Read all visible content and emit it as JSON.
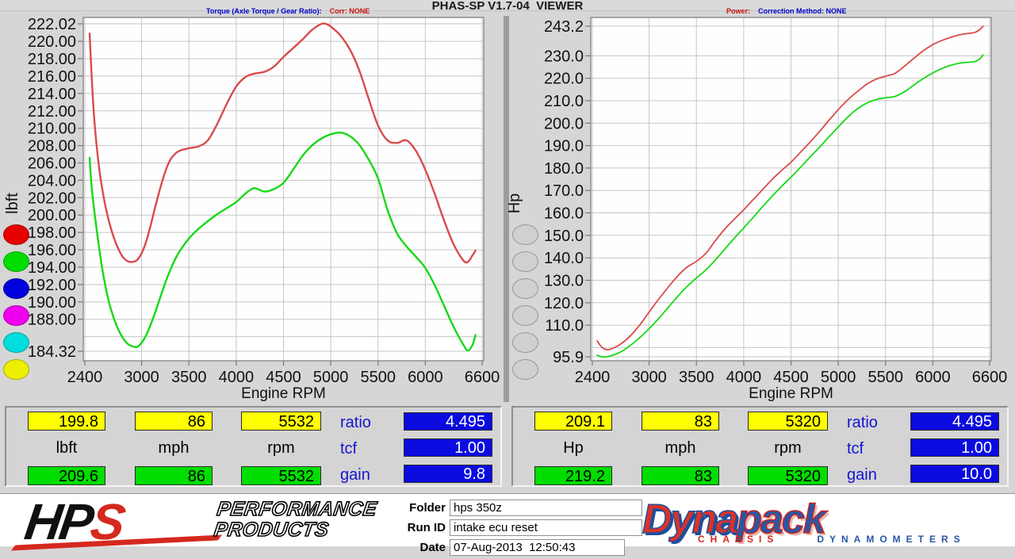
{
  "window": {
    "title": "PHAS-SP V1.7-04_VIEWER"
  },
  "header": {
    "torque_label": "Torque (Axle Torque / Gear Ratio):",
    "torque_corr": "Corr: NONE",
    "power_label": "Power:",
    "power_corr": "Correction Method: NONE"
  },
  "run_buttons": {
    "left": [
      {
        "name": "red",
        "color": "#e60000"
      },
      {
        "name": "green",
        "color": "#00dd00"
      },
      {
        "name": "blue",
        "color": "#0000dd"
      },
      {
        "name": "magenta",
        "color": "#ee00ee"
      },
      {
        "name": "cyan",
        "color": "#00dddd"
      },
      {
        "name": "yellow",
        "color": "#eeee00"
      }
    ],
    "right": [
      {
        "name": "slot-1",
        "color": "#d0d0d0"
      },
      {
        "name": "slot-2",
        "color": "#d0d0d0"
      },
      {
        "name": "slot-3",
        "color": "#d0d0d0"
      },
      {
        "name": "slot-4",
        "color": "#d0d0d0"
      },
      {
        "name": "slot-5",
        "color": "#d0d0d0"
      },
      {
        "name": "slot-6",
        "color": "#d0d0d0"
      }
    ]
  },
  "chart_data": [
    {
      "type": "line",
      "title": "Torque",
      "xlabel": "Engine RPM",
      "ylabel": "lbft",
      "xlim": [
        2400,
        6600
      ],
      "ylim": [
        184.32,
        222.02
      ],
      "grid": true,
      "x_ticks": [
        2400,
        3000,
        3500,
        4000,
        4500,
        5000,
        5500,
        6000,
        6600
      ],
      "x_tick_labels": [
        "2400",
        "3000",
        "3500",
        "4000",
        "4500",
        "5000",
        "5500",
        "6000",
        "6600"
      ],
      "y_ticks": [
        222.02,
        220,
        218,
        216,
        214,
        212,
        210,
        208,
        206,
        204,
        202,
        200,
        198,
        196,
        194,
        192,
        190,
        188,
        186,
        184.32
      ],
      "y_tick_labels": [
        "222.02",
        "220.00",
        "218.00",
        "216.00",
        "214.00",
        "212.00",
        "210.00",
        "208.00",
        "206.00",
        "204.00",
        "202.00",
        "200.00",
        "198.00",
        "196.00",
        "194.00",
        "192.00",
        "190.00",
        "188.00",
        "",
        "184.32"
      ],
      "series": [
        {
          "name": "red-run-torque",
          "color": "#d94b4b",
          "points": [
            [
              2450,
              220.9
            ],
            [
              2470,
              216.5
            ],
            [
              2500,
              211.0
            ],
            [
              2550,
              205.5
            ],
            [
              2600,
              202.0
            ],
            [
              2650,
              199.5
            ],
            [
              2700,
              197.6
            ],
            [
              2750,
              196.2
            ],
            [
              2800,
              195.2
            ],
            [
              2850,
              194.7
            ],
            [
              2900,
              194.6
            ],
            [
              2950,
              194.8
            ],
            [
              3000,
              195.6
            ],
            [
              3050,
              197.0
            ],
            [
              3100,
              199.0
            ],
            [
              3150,
              201.2
            ],
            [
              3200,
              203.2
            ],
            [
              3250,
              205.0
            ],
            [
              3300,
              206.3
            ],
            [
              3350,
              207.0
            ],
            [
              3400,
              207.4
            ],
            [
              3500,
              207.7
            ],
            [
              3600,
              207.9
            ],
            [
              3700,
              208.6
            ],
            [
              3800,
              210.5
            ],
            [
              3900,
              212.8
            ],
            [
              4000,
              214.8
            ],
            [
              4100,
              215.9
            ],
            [
              4200,
              216.3
            ],
            [
              4300,
              216.5
            ],
            [
              4400,
              217.1
            ],
            [
              4500,
              218.2
            ],
            [
              4600,
              219.2
            ],
            [
              4700,
              220.2
            ],
            [
              4800,
              221.3
            ],
            [
              4900,
              222.0
            ],
            [
              4950,
              222.0
            ],
            [
              5000,
              221.7
            ],
            [
              5100,
              220.7
            ],
            [
              5200,
              219.1
            ],
            [
              5300,
              216.7
            ],
            [
              5400,
              213.4
            ],
            [
              5500,
              210.3
            ],
            [
              5600,
              208.6
            ],
            [
              5700,
              208.3
            ],
            [
              5800,
              208.6
            ],
            [
              5900,
              207.4
            ],
            [
              6000,
              205.2
            ],
            [
              6100,
              202.4
            ],
            [
              6200,
              199.3
            ],
            [
              6300,
              196.6
            ],
            [
              6400,
              194.8
            ],
            [
              6450,
              194.6
            ],
            [
              6500,
              195.4
            ],
            [
              6530,
              195.9
            ]
          ]
        },
        {
          "name": "green-run-torque",
          "color": "#16d916",
          "points": [
            [
              2450,
              206.6
            ],
            [
              2470,
              203.5
            ],
            [
              2500,
              200.5
            ],
            [
              2550,
              196.3
            ],
            [
              2600,
              192.8
            ],
            [
              2650,
              190.2
            ],
            [
              2700,
              188.3
            ],
            [
              2750,
              186.9
            ],
            [
              2800,
              185.9
            ],
            [
              2850,
              185.2
            ],
            [
              2900,
              184.9
            ],
            [
              2950,
              184.8
            ],
            [
              3000,
              185.3
            ],
            [
              3050,
              186.2
            ],
            [
              3100,
              187.5
            ],
            [
              3150,
              189.0
            ],
            [
              3200,
              190.6
            ],
            [
              3250,
              192.2
            ],
            [
              3300,
              193.6
            ],
            [
              3350,
              194.8
            ],
            [
              3400,
              195.8
            ],
            [
              3500,
              197.3
            ],
            [
              3600,
              198.4
            ],
            [
              3700,
              199.3
            ],
            [
              3800,
              200.1
            ],
            [
              3900,
              200.8
            ],
            [
              4000,
              201.5
            ],
            [
              4100,
              202.5
            ],
            [
              4150,
              202.9
            ],
            [
              4200,
              203.1
            ],
            [
              4300,
              202.7
            ],
            [
              4400,
              203.0
            ],
            [
              4500,
              203.7
            ],
            [
              4600,
              205.2
            ],
            [
              4700,
              206.8
            ],
            [
              4800,
              208.0
            ],
            [
              4900,
              208.8
            ],
            [
              5000,
              209.3
            ],
            [
              5100,
              209.5
            ],
            [
              5200,
              209.1
            ],
            [
              5300,
              208.1
            ],
            [
              5400,
              206.4
            ],
            [
              5500,
              204.2
            ],
            [
              5600,
              200.6
            ],
            [
              5700,
              197.9
            ],
            [
              5800,
              196.4
            ],
            [
              5900,
              195.2
            ],
            [
              6000,
              193.9
            ],
            [
              6100,
              191.9
            ],
            [
              6200,
              189.5
            ],
            [
              6300,
              187.1
            ],
            [
              6400,
              185.1
            ],
            [
              6450,
              184.4
            ],
            [
              6500,
              185.1
            ],
            [
              6530,
              186.2
            ]
          ]
        }
      ]
    },
    {
      "type": "line",
      "title": "Power",
      "xlabel": "Engine RPM",
      "ylabel": "Hp",
      "xlim": [
        2400,
        6600
      ],
      "ylim": [
        95.9,
        243.2
      ],
      "grid": true,
      "x_ticks": [
        2400,
        3000,
        3500,
        4000,
        4500,
        5000,
        5500,
        6000,
        6600
      ],
      "x_tick_labels": [
        "2400",
        "3000",
        "3500",
        "4000",
        "4500",
        "5000",
        "5500",
        "6000",
        "6600"
      ],
      "y_ticks": [
        243.2,
        230,
        220,
        210,
        200,
        190,
        180,
        170,
        160,
        150,
        140,
        130,
        120,
        110,
        100,
        95.9
      ],
      "y_tick_labels": [
        "243.2",
        "230.0",
        "220.0",
        "210.0",
        "200.0",
        "190.0",
        "180.0",
        "170.0",
        "160.0",
        "150.0",
        "140.0",
        "130.0",
        "120.0",
        "110.0",
        "",
        "95.9"
      ],
      "series": [
        {
          "name": "red-run-power",
          "color": "#d94b4b",
          "points": [
            [
              2450,
              103.0
            ],
            [
              2500,
              100.2
            ],
            [
              2550,
              99.1
            ],
            [
              2600,
              99.4
            ],
            [
              2700,
              101.6
            ],
            [
              2800,
              105.2
            ],
            [
              2900,
              110.0
            ],
            [
              3000,
              115.8
            ],
            [
              3100,
              121.5
            ],
            [
              3200,
              126.8
            ],
            [
              3300,
              131.8
            ],
            [
              3400,
              135.8
            ],
            [
              3500,
              138.4
            ],
            [
              3600,
              142.0
            ],
            [
              3700,
              147.6
            ],
            [
              3800,
              152.8
            ],
            [
              3900,
              157.2
            ],
            [
              4000,
              161.4
            ],
            [
              4100,
              165.9
            ],
            [
              4200,
              170.4
            ],
            [
              4300,
              174.9
            ],
            [
              4400,
              178.9
            ],
            [
              4500,
              182.6
            ],
            [
              4600,
              187.0
            ],
            [
              4700,
              191.5
            ],
            [
              4800,
              196.2
            ],
            [
              4900,
              201.2
            ],
            [
              5000,
              206.0
            ],
            [
              5100,
              210.4
            ],
            [
              5200,
              214.0
            ],
            [
              5300,
              217.3
            ],
            [
              5400,
              219.6
            ],
            [
              5500,
              220.9
            ],
            [
              5600,
              222.2
            ],
            [
              5700,
              225.4
            ],
            [
              5800,
              228.9
            ],
            [
              5900,
              232.3
            ],
            [
              6000,
              235.0
            ],
            [
              6100,
              236.9
            ],
            [
              6200,
              238.4
            ],
            [
              6300,
              239.5
            ],
            [
              6400,
              240.1
            ],
            [
              6450,
              240.5
            ],
            [
              6500,
              241.8
            ],
            [
              6530,
              243.2
            ]
          ]
        },
        {
          "name": "green-run-power",
          "color": "#16d916",
          "points": [
            [
              2450,
              96.6
            ],
            [
              2500,
              95.9
            ],
            [
              2550,
              95.9
            ],
            [
              2600,
              96.4
            ],
            [
              2700,
              98.1
            ],
            [
              2800,
              100.9
            ],
            [
              2900,
              104.4
            ],
            [
              3000,
              108.4
            ],
            [
              3100,
              112.9
            ],
            [
              3200,
              117.8
            ],
            [
              3300,
              122.7
            ],
            [
              3400,
              127.2
            ],
            [
              3500,
              131.0
            ],
            [
              3600,
              134.6
            ],
            [
              3700,
              139.0
            ],
            [
              3800,
              143.9
            ],
            [
              3900,
              148.7
            ],
            [
              4000,
              153.3
            ],
            [
              4100,
              158.0
            ],
            [
              4200,
              162.8
            ],
            [
              4300,
              167.4
            ],
            [
              4400,
              171.8
            ],
            [
              4500,
              175.9
            ],
            [
              4600,
              180.3
            ],
            [
              4700,
              184.8
            ],
            [
              4800,
              189.2
            ],
            [
              4900,
              193.8
            ],
            [
              5000,
              198.3
            ],
            [
              5100,
              202.7
            ],
            [
              5200,
              206.3
            ],
            [
              5300,
              208.9
            ],
            [
              5400,
              210.5
            ],
            [
              5500,
              211.3
            ],
            [
              5600,
              211.9
            ],
            [
              5700,
              214.0
            ],
            [
              5800,
              217.0
            ],
            [
              5900,
              219.9
            ],
            [
              6000,
              222.4
            ],
            [
              6100,
              224.4
            ],
            [
              6200,
              225.9
            ],
            [
              6300,
              226.8
            ],
            [
              6400,
              227.2
            ],
            [
              6450,
              227.5
            ],
            [
              6500,
              228.8
            ],
            [
              6530,
              230.4
            ]
          ]
        }
      ]
    }
  ],
  "panels": [
    {
      "top_values": [
        "199.8",
        "86",
        "5532"
      ],
      "unit_labels": [
        "lbft",
        "mph",
        "rpm"
      ],
      "bottom_values": [
        "209.6",
        "86",
        "5532"
      ],
      "stats": [
        {
          "label": "ratio",
          "value": "4.495"
        },
        {
          "label": "tcf",
          "value": "1.00"
        },
        {
          "label": "gain",
          "value": "9.8"
        }
      ]
    },
    {
      "top_values": [
        "209.1",
        "83",
        "5320"
      ],
      "unit_labels": [
        "Hp",
        "mph",
        "rpm"
      ],
      "bottom_values": [
        "219.2",
        "83",
        "5320"
      ],
      "stats": [
        {
          "label": "ratio",
          "value": "4.495"
        },
        {
          "label": "tcf",
          "value": "1.00"
        },
        {
          "label": "gain",
          "value": "10.0"
        }
      ]
    }
  ],
  "footer": {
    "fields": [
      {
        "label": "Folder",
        "value": "hps 350z"
      },
      {
        "label": "Run ID",
        "value": "intake ecu reset"
      },
      {
        "label": "Date",
        "value": "07-Aug-2013  12:50:43"
      }
    ],
    "hps_logo": {
      "hp": "HP",
      "s": "S",
      "line1": "PERFORMANCE",
      "line2": "PRODUCTS"
    },
    "dynapack_logo": {
      "part1": "Dyna",
      "part2": "pack",
      "sub1": "CHASSIS",
      "sub2": "DYNAMOMETERS"
    }
  }
}
